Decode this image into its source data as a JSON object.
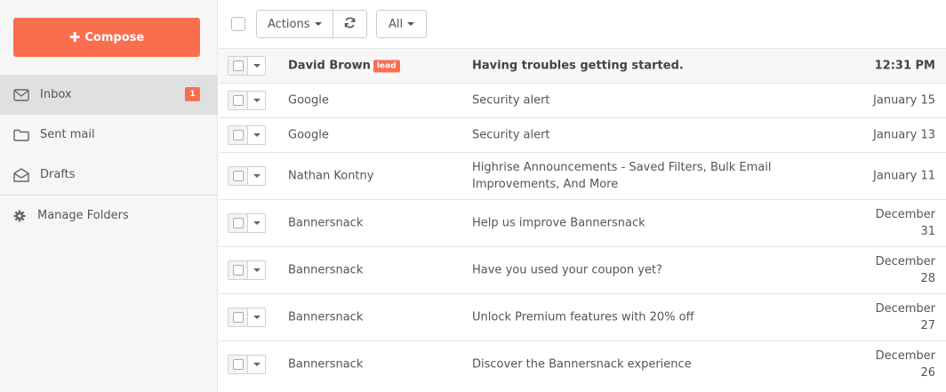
{
  "sidebar": {
    "compose_label": "Compose",
    "folders": [
      {
        "label": "Inbox",
        "icon": "envelope-icon",
        "badge": "1",
        "active": true
      },
      {
        "label": "Sent mail",
        "icon": "folder-icon",
        "badge": null,
        "active": false
      },
      {
        "label": "Drafts",
        "icon": "envelope-open-icon",
        "badge": null,
        "active": false
      }
    ],
    "manage_label": "Manage Folders"
  },
  "toolbar": {
    "actions_label": "Actions",
    "filter_label": "All"
  },
  "colors": {
    "accent": "#fa6e50",
    "sidebar_bg": "#f6f6f6",
    "active_item_bg": "#e0e0e0"
  },
  "messages": [
    {
      "sender": "David Brown",
      "tag": "lead",
      "subject": "Having troubles getting started.",
      "date": "12:31 PM",
      "unread": true
    },
    {
      "sender": "Google",
      "tag": null,
      "subject": "Security alert",
      "date": "January 15",
      "unread": false
    },
    {
      "sender": "Google",
      "tag": null,
      "subject": "Security alert",
      "date": "January 13",
      "unread": false
    },
    {
      "sender": "Nathan Kontny",
      "tag": null,
      "subject": "Highrise Announcements - Saved Filters, Bulk Email Improvements, And More",
      "date": "January 11",
      "unread": false
    },
    {
      "sender": "Bannersnack",
      "tag": null,
      "subject": "Help us improve Bannersnack",
      "date": "December 31",
      "unread": false
    },
    {
      "sender": "Bannersnack",
      "tag": null,
      "subject": "Have you used your coupon yet?",
      "date": "December 28",
      "unread": false
    },
    {
      "sender": "Bannersnack",
      "tag": null,
      "subject": "Unlock Premium features with 20% off",
      "date": "December 27",
      "unread": false
    },
    {
      "sender": "Bannersnack",
      "tag": null,
      "subject": "Discover the Bannersnack experience",
      "date": "December 26",
      "unread": false
    }
  ]
}
